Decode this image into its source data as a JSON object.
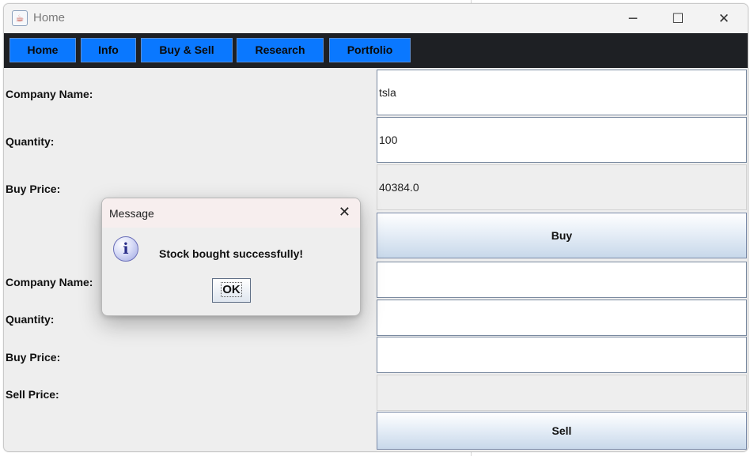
{
  "window": {
    "title": "Home",
    "minimize_glyph": "─",
    "maximize_glyph": "☐",
    "close_glyph": "✕",
    "app_icon": "java-cup-icon"
  },
  "nav": {
    "items": [
      {
        "label": "Home"
      },
      {
        "label": "Info"
      },
      {
        "label": "Buy & Sell"
      },
      {
        "label": "Research"
      },
      {
        "label": "Portfolio"
      }
    ],
    "button_color": "#0a78ff",
    "bar_color": "#1e2024"
  },
  "buy": {
    "company_label": "Company Name:",
    "company_value": "tsla",
    "quantity_label": "Quantity:",
    "quantity_value": "100",
    "price_label": "Buy Price:",
    "price_value": "40384.0",
    "button_label": "Buy"
  },
  "sell": {
    "company_label": "Company Name:",
    "company_value": "",
    "quantity_label": "Quantity:",
    "quantity_value": "",
    "buy_price_label": "Buy Price:",
    "buy_price_value": "",
    "sell_price_label": "Sell Price:",
    "sell_price_value": "",
    "button_label": "Sell"
  },
  "dialog": {
    "title": "Message",
    "close_glyph": "✕",
    "icon": "information-icon",
    "icon_glyph": "i",
    "message": "Stock bought successfully!",
    "ok_label": "OK"
  }
}
